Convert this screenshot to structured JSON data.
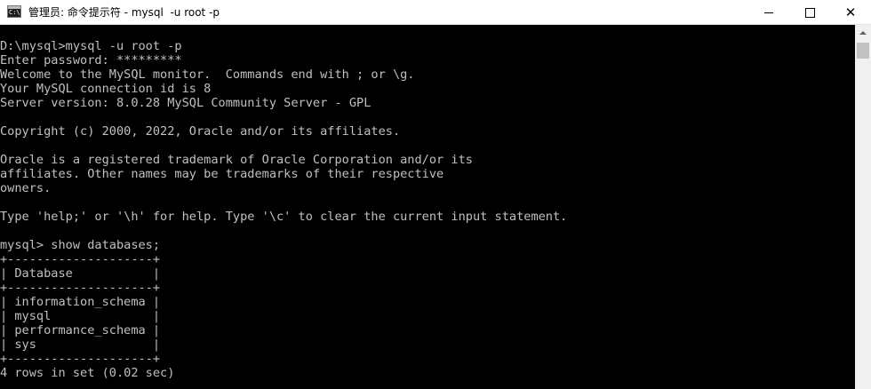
{
  "window": {
    "title": "管理员: 命令提示符 - mysql  -u root -p",
    "icon_glyph": "C:\\",
    "icon_name": "cmd-app-icon",
    "minimize_label": "minimize",
    "maximize_label": "maximize",
    "close_label": "✕"
  },
  "console": {
    "lines": [
      "D:\\mysql>mysql -u root -p",
      "Enter password: *********",
      "Welcome to the MySQL monitor.  Commands end with ; or \\g.",
      "Your MySQL connection id is 8",
      "Server version: 8.0.28 MySQL Community Server - GPL",
      "",
      "Copyright (c) 2000, 2022, Oracle and/or its affiliates.",
      "",
      "Oracle is a registered trademark of Oracle Corporation and/or its",
      "affiliates. Other names may be trademarks of their respective",
      "owners.",
      "",
      "Type 'help;' or '\\h' for help. Type '\\c' to clear the current input statement.",
      "",
      "mysql> show databases;",
      "+--------------------+",
      "| Database           |",
      "+--------------------+",
      "| information_schema |",
      "| mysql              |",
      "| performance_schema |",
      "| sys                |",
      "+--------------------+",
      "4 rows in set (0.02 sec)"
    ]
  },
  "colors": {
    "console_background": "#000000",
    "console_text": "#c0c0c0",
    "titlebar_background": "#ffffff"
  }
}
